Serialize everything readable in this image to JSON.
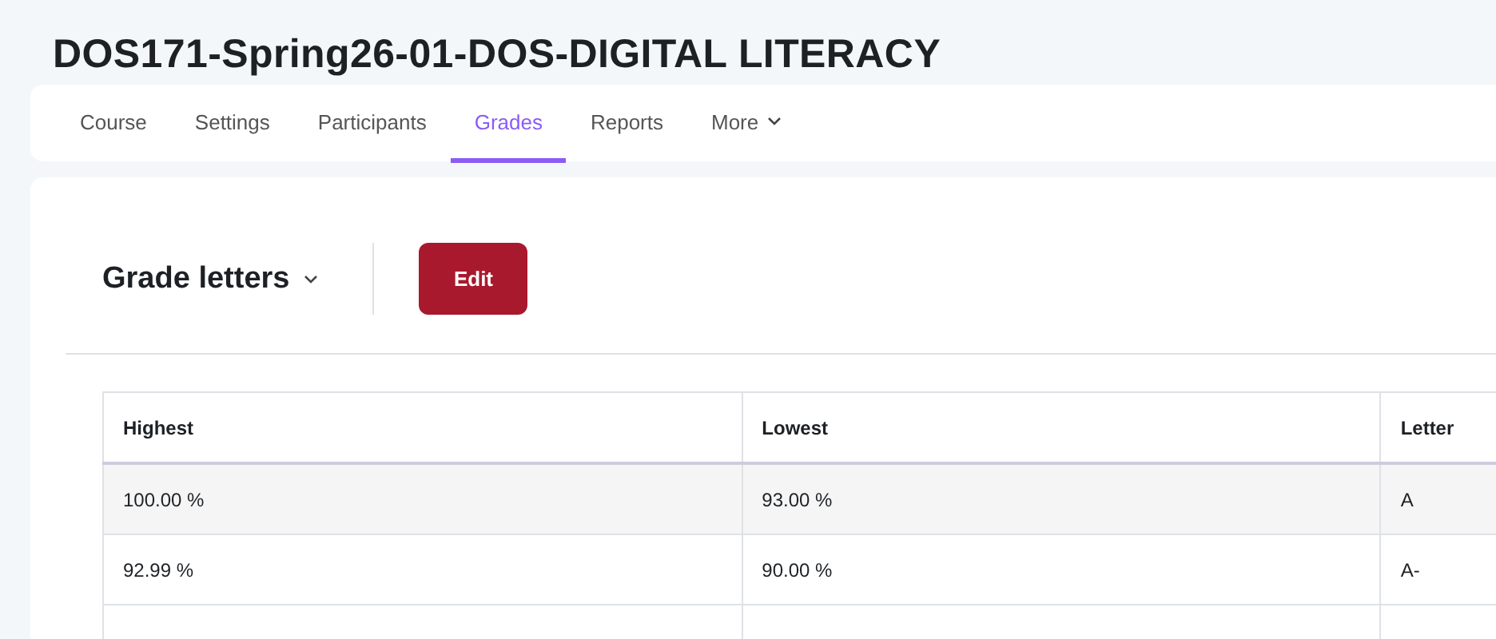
{
  "page_title": "DOS171-Spring26-01-DOS-DIGITAL LITERACY",
  "nav_tabs": [
    {
      "label": "Course",
      "selected": false
    },
    {
      "label": "Settings",
      "selected": false
    },
    {
      "label": "Participants",
      "selected": false
    },
    {
      "label": "Grades",
      "selected": true
    },
    {
      "label": "Reports",
      "selected": false
    },
    {
      "label": "More",
      "selected": false,
      "kind": "dropdown"
    }
  ],
  "page_header": {
    "title": "Grade letters",
    "button": "Edit"
  },
  "table": {
    "columns": [
      "Highest",
      "Lowest",
      "Letter"
    ],
    "rows": [
      [
        "100.00 %",
        "93.00 %",
        "A"
      ],
      [
        "92.99 %",
        "90.00 %",
        "A-"
      ]
    ]
  }
}
